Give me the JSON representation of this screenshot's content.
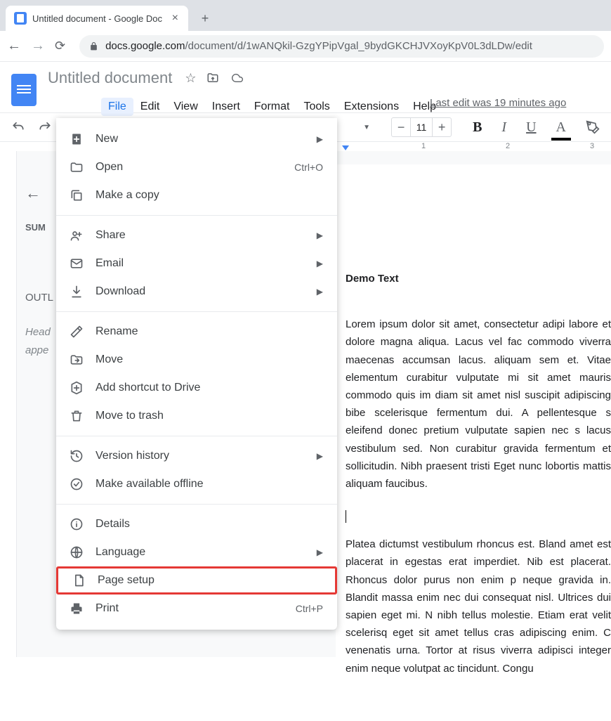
{
  "browser": {
    "tab_title": "Untitled document - Google Doc",
    "url_domain": "docs.google.com",
    "url_path": "/document/d/1wANQkil-GzgYPipVgal_9bydGKCHJVXoyKpV0L3dLDw/edit"
  },
  "docs": {
    "title": "Untitled document",
    "last_edit": "Last edit was 19 minutes ago",
    "font_size": "11"
  },
  "menubar": [
    "File",
    "Edit",
    "View",
    "Insert",
    "Format",
    "Tools",
    "Extensions",
    "Help"
  ],
  "file_menu": [
    {
      "icon": "plus-doc",
      "label": "New",
      "chevron": true
    },
    {
      "icon": "folder",
      "label": "Open",
      "shortcut": "Ctrl+O"
    },
    {
      "icon": "copy",
      "label": "Make a copy"
    },
    {
      "sep": true
    },
    {
      "icon": "share",
      "label": "Share",
      "chevron": true
    },
    {
      "icon": "mail",
      "label": "Email",
      "chevron": true
    },
    {
      "icon": "download",
      "label": "Download",
      "chevron": true
    },
    {
      "sep": true
    },
    {
      "icon": "rename",
      "label": "Rename"
    },
    {
      "icon": "move",
      "label": "Move"
    },
    {
      "icon": "shortcut",
      "label": "Add shortcut to Drive"
    },
    {
      "icon": "trash",
      "label": "Move to trash"
    },
    {
      "sep": true
    },
    {
      "icon": "history",
      "label": "Version history",
      "chevron": true
    },
    {
      "icon": "offline",
      "label": "Make available offline"
    },
    {
      "sep": true
    },
    {
      "icon": "info",
      "label": "Details"
    },
    {
      "icon": "globe",
      "label": "Language",
      "chevron": true
    },
    {
      "icon": "page",
      "label": "Page setup",
      "highlight": true
    },
    {
      "icon": "print",
      "label": "Print",
      "shortcut": "Ctrl+P"
    }
  ],
  "ruler_ticks": [
    "1",
    "2",
    "3"
  ],
  "outline": {
    "summary": "SUM",
    "heading": "OUTL",
    "body_l1": "Head",
    "body_l2": "appe"
  },
  "document": {
    "heading": "Demo Text",
    "para1": "Lorem ipsum dolor sit amet, consectetur adipi labore et dolore magna aliqua. Lacus vel fac commodo viverra maecenas accumsan lacus. aliquam sem et. Vitae elementum curabitur vulputate mi sit amet mauris commodo quis im diam sit amet nisl suscipit adipiscing bibe scelerisque fermentum dui. A pellentesque s eleifend donec pretium vulputate sapien nec s lacus vestibulum sed. Non curabitur gravida fermentum et sollicitudin. Nibh praesent tristi Eget nunc lobortis mattis aliquam faucibus.",
    "para2": "Platea dictumst vestibulum rhoncus est. Bland amet est placerat in egestas erat imperdiet. Nib est placerat. Rhoncus dolor purus non enim p neque gravida in. Blandit massa enim nec dui consequat nisl. Ultrices dui sapien eget mi. N nibh tellus molestie. Etiam erat velit scelerisq eget sit amet tellus cras adipiscing enim. C venenatis urna. Tortor at risus viverra adipisci integer enim neque volutpat ac tincidunt. Congu"
  }
}
